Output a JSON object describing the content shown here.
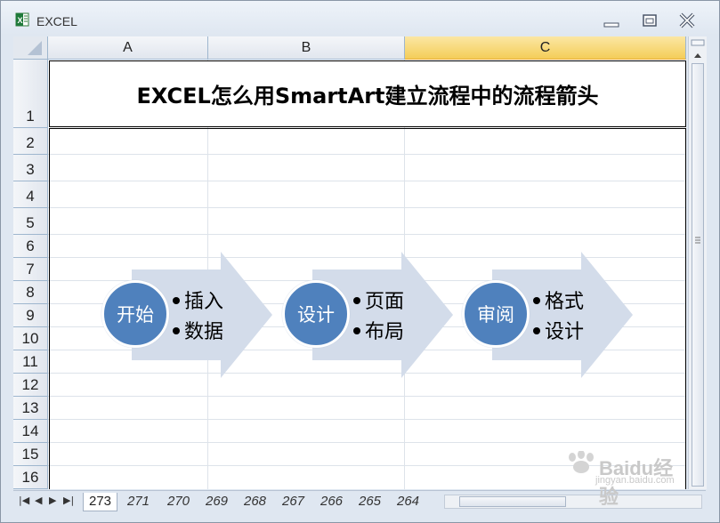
{
  "window": {
    "title": "EXCEL"
  },
  "columns": [
    "A",
    "B",
    "C"
  ],
  "selected_column": "C",
  "rows": [
    "1",
    "2",
    "3",
    "4",
    "5",
    "6",
    "7",
    "8",
    "9",
    "10",
    "11",
    "12",
    "13",
    "14",
    "15",
    "16"
  ],
  "cell_title": "EXCEL怎么用SmartArt建立流程中的流程箭头",
  "steps": [
    {
      "label": "开始",
      "bullets": [
        "插入",
        "数据"
      ]
    },
    {
      "label": "设计",
      "bullets": [
        "页面",
        "布局"
      ]
    },
    {
      "label": "审阅",
      "bullets": [
        "格式",
        "设计"
      ]
    }
  ],
  "colors": {
    "circle": "#4f81bd",
    "arrow": "#d3dcea",
    "selected_header": "#f4cd58"
  },
  "sheet_tabs": [
    "273",
    "271",
    "270",
    "269",
    "268",
    "267",
    "266",
    "265",
    "264"
  ],
  "active_tab": "273",
  "watermark": {
    "brand": "Baidu经验",
    "url": "jingyan.baidu.com"
  }
}
